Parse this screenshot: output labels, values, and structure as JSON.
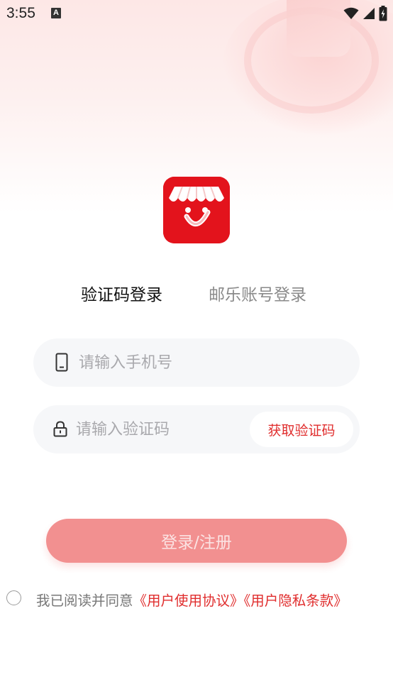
{
  "status_bar": {
    "time": "3:55",
    "notification_badge": "A",
    "icons": [
      "wifi-icon",
      "signal-icon",
      "battery-charging-icon"
    ]
  },
  "logo": {
    "icon": "shop-awning-smile-logo",
    "color": "#e3131c"
  },
  "tabs": {
    "active_label": "验证码登录",
    "inactive_label": "邮乐账号登录"
  },
  "phone_field": {
    "placeholder": "请输入手机号",
    "value": "",
    "icon": "phone-icon"
  },
  "code_field": {
    "placeholder": "请输入验证码",
    "value": "",
    "icon": "lock-icon"
  },
  "get_code_label": "获取验证码",
  "submit_label": "登录/注册",
  "agreement": {
    "prefix": "我已阅读并同意",
    "user_agreement": "《用户使用协议》",
    "privacy_policy": "《用户隐私条款》",
    "checked": false
  },
  "colors": {
    "accent": "#e02d2d",
    "submit_bg": "#f28b8b",
    "field_bg": "#f6f7f9"
  }
}
